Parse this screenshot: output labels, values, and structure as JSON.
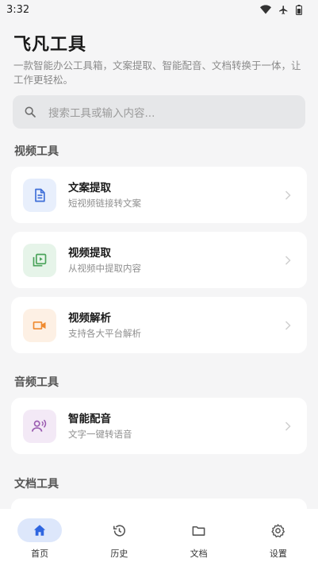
{
  "status_bar": {
    "time": "3:32",
    "icons": [
      "wifi-icon",
      "airplane-icon",
      "battery-icon"
    ]
  },
  "header": {
    "title": "飞凡工具",
    "description": "一款智能办公工具箱，文案提取、智能配音、文档转换于一体，让工作更轻松。"
  },
  "search": {
    "placeholder": "搜索工具或输入内容..."
  },
  "sections": {
    "video": {
      "title": "视频工具",
      "cards": [
        {
          "title": "文案提取",
          "subtitle": "短视频链接转文案",
          "icon": "document-icon",
          "color": "#3f6fd8",
          "bg": "#e8effc"
        },
        {
          "title": "视频提取",
          "subtitle": "从视频中提取内容",
          "icon": "video-library-icon",
          "color": "#4aa35a",
          "bg": "#e6f4e9"
        },
        {
          "title": "视频解析",
          "subtitle": "支持各大平台解析",
          "icon": "video-camera-icon",
          "color": "#ef8a2f",
          "bg": "#fdf0e4"
        }
      ]
    },
    "audio": {
      "title": "音频工具",
      "cards": [
        {
          "title": "智能配音",
          "subtitle": "文字一键转语音",
          "icon": "voice-user-icon",
          "color": "#9a5bb0",
          "bg": "#f3e9f6"
        }
      ]
    },
    "document": {
      "title": "文档工具"
    }
  },
  "bottom_nav": {
    "items": [
      {
        "label": "首页",
        "icon": "home-icon",
        "active": true
      },
      {
        "label": "历史",
        "icon": "history-icon",
        "active": false
      },
      {
        "label": "文档",
        "icon": "folder-icon",
        "active": false
      },
      {
        "label": "设置",
        "icon": "gear-icon",
        "active": false
      }
    ],
    "accent": "#2f66e0"
  }
}
